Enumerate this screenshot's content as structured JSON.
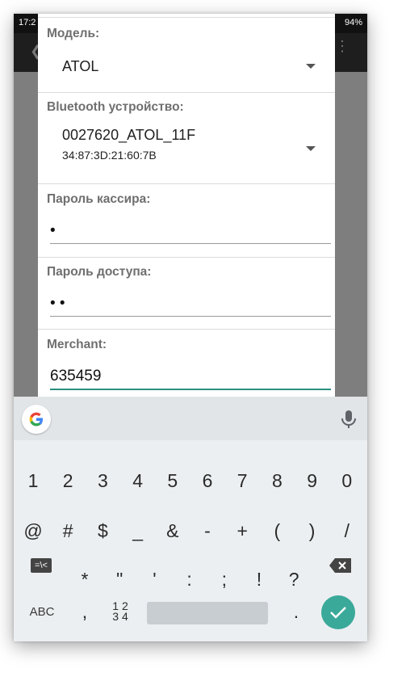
{
  "status": {
    "time": "17:2",
    "battery": "94%"
  },
  "dialog": {
    "model_label": "Модель:",
    "model_value": "ATOL",
    "bt_label": "Bluetooth устройство:",
    "bt_name": "0027620_ATOL_11F",
    "bt_mac": "34:87:3D:21:60:7B",
    "cashier_label": "Пароль кассира:",
    "cashier_value": "•",
    "access_label": "Пароль доступа:",
    "access_value": "• •",
    "merchant_label": "Merchant:",
    "merchant_value": "635459"
  },
  "keyboard": {
    "row1": [
      "1",
      "2",
      "3",
      "4",
      "5",
      "6",
      "7",
      "8",
      "9",
      "0"
    ],
    "row2": [
      "@",
      "#",
      "$",
      "_",
      "&",
      "-",
      "+",
      "(",
      ")",
      "/"
    ],
    "row3": [
      "*",
      "\"",
      "'",
      ":",
      ";",
      "!",
      "?"
    ],
    "symbols_key": "=\\<",
    "abc_key": "ABC",
    "comma_key": ",",
    "numpad_top": "1 2",
    "numpad_bottom": "3 4",
    "period_key": ".",
    "accent_color": "#3aa99a"
  }
}
